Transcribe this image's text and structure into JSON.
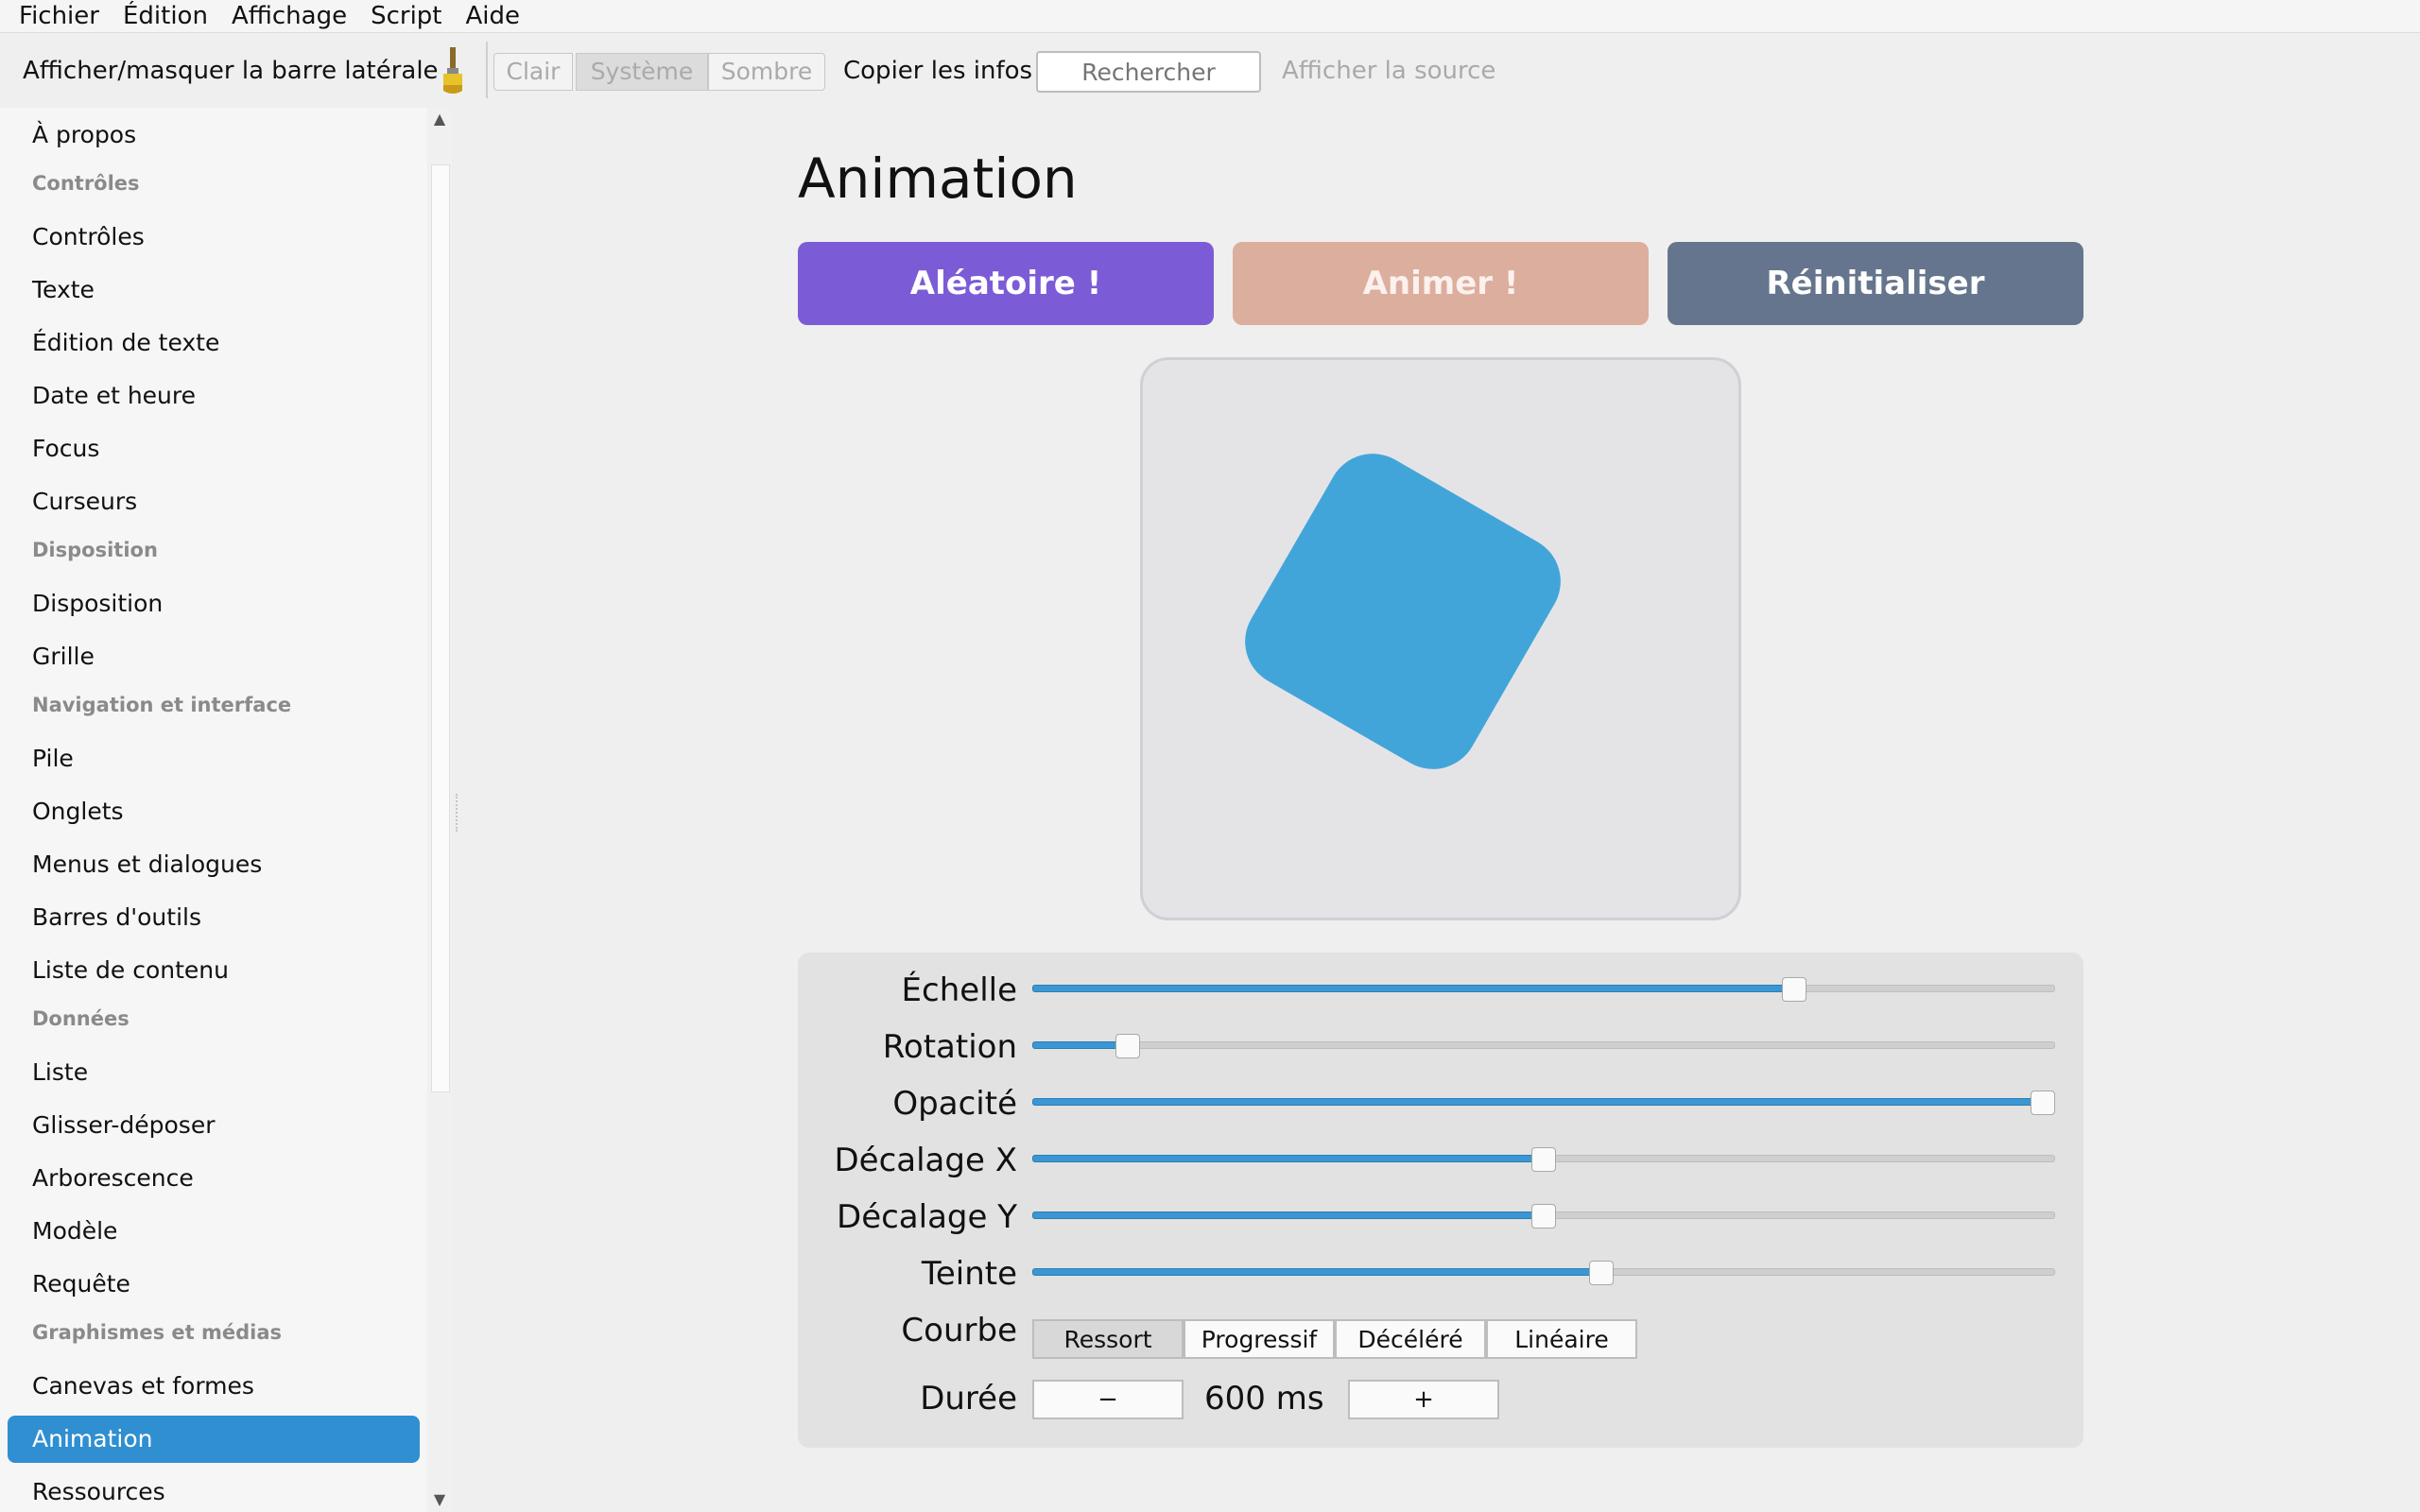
{
  "menubar": {
    "items": [
      "Fichier",
      "Édition",
      "Affichage",
      "Script",
      "Aide"
    ]
  },
  "toolbar": {
    "toggle_sidebar": "Afficher/masquer la barre latérale",
    "brush_icon": "paintbrush-icon",
    "themes": [
      "Clair",
      "Système",
      "Sombre"
    ],
    "selected_theme": "Système",
    "copy_info": "Copier les infos",
    "search_placeholder": "Rechercher",
    "view_source": "Afficher la source"
  },
  "sidebar": {
    "entries": [
      {
        "kind": "item",
        "label": "À propos"
      },
      {
        "kind": "header",
        "label": "Contrôles"
      },
      {
        "kind": "item",
        "label": "Contrôles"
      },
      {
        "kind": "item",
        "label": "Texte"
      },
      {
        "kind": "item",
        "label": "Édition de texte"
      },
      {
        "kind": "item",
        "label": "Date et heure"
      },
      {
        "kind": "item",
        "label": "Focus"
      },
      {
        "kind": "item",
        "label": "Curseurs"
      },
      {
        "kind": "header",
        "label": "Disposition"
      },
      {
        "kind": "item",
        "label": "Disposition"
      },
      {
        "kind": "item",
        "label": "Grille"
      },
      {
        "kind": "header",
        "label": "Navigation et interface"
      },
      {
        "kind": "item",
        "label": "Pile"
      },
      {
        "kind": "item",
        "label": "Onglets"
      },
      {
        "kind": "item",
        "label": "Menus et dialogues"
      },
      {
        "kind": "item",
        "label": "Barres d'outils"
      },
      {
        "kind": "item",
        "label": "Liste de contenu"
      },
      {
        "kind": "header",
        "label": "Données"
      },
      {
        "kind": "item",
        "label": "Liste"
      },
      {
        "kind": "item",
        "label": "Glisser-déposer"
      },
      {
        "kind": "item",
        "label": "Arborescence"
      },
      {
        "kind": "item",
        "label": "Modèle"
      },
      {
        "kind": "item",
        "label": "Requête"
      },
      {
        "kind": "header",
        "label": "Graphismes et médias"
      },
      {
        "kind": "item",
        "label": "Canevas et formes"
      },
      {
        "kind": "item",
        "label": "Animation",
        "active": true
      },
      {
        "kind": "item",
        "label": "Ressources"
      }
    ]
  },
  "main": {
    "title": "Animation",
    "buttons": {
      "random": "Aléatoire !",
      "animate": "Animer !",
      "reset": "Réinitialiser"
    },
    "colors": {
      "random": "#7b5cd6",
      "animate": "#dcae9d",
      "reset": "#65758d",
      "shape": "#42a5d9",
      "accent": "#2f8fd0"
    },
    "shape": {
      "rotation_deg": 30
    },
    "sliders": [
      {
        "label": "Échelle",
        "value": 0.745
      },
      {
        "label": "Rotation",
        "value": 0.093
      },
      {
        "label": "Opacité",
        "value": 1.0
      },
      {
        "label": "Décalage X",
        "value": 0.5
      },
      {
        "label": "Décalage Y",
        "value": 0.5
      },
      {
        "label": "Teinte",
        "value": 0.556
      }
    ],
    "curve": {
      "label": "Courbe",
      "options": [
        "Ressort",
        "Progressif",
        "Décéléré",
        "Linéaire"
      ],
      "selected": "Ressort"
    },
    "duration": {
      "label": "Durée",
      "minus": "−",
      "plus": "+",
      "value": "600 ms"
    }
  }
}
